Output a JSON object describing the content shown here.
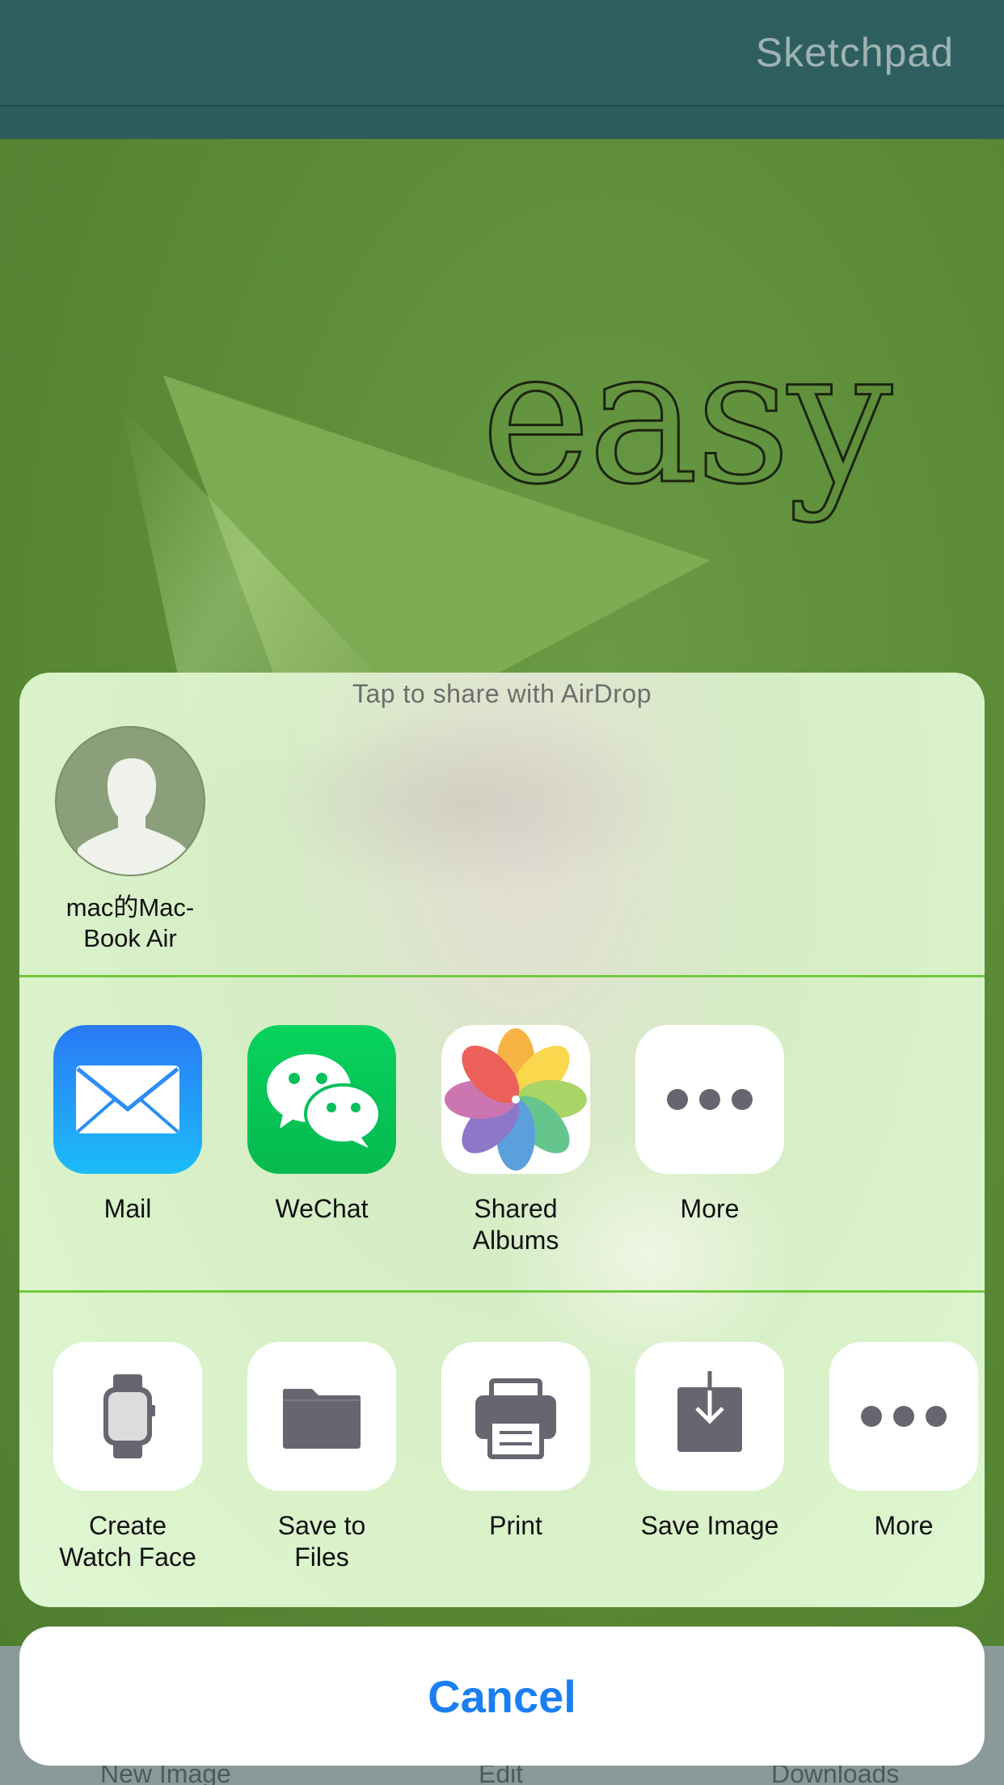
{
  "navbar": {
    "title": "Sketchpad"
  },
  "canvas": {
    "artwork_text": "easy"
  },
  "toolbar": {
    "items": [
      "New Image",
      "Edit",
      "Downloads"
    ]
  },
  "share_sheet": {
    "airdrop_hint": "Tap to share with AirDrop",
    "airdrop_device": {
      "name": "mac的Mac-\nBook Air"
    },
    "apps": [
      {
        "label": "Mail",
        "icon": "mail-icon"
      },
      {
        "label": "WeChat",
        "icon": "wechat-icon"
      },
      {
        "label": "Shared\nAlbums",
        "icon": "photos-icon"
      },
      {
        "label": "More",
        "icon": "more-icon"
      }
    ],
    "actions": [
      {
        "label": "Create\nWatch Face",
        "icon": "watch-icon"
      },
      {
        "label": "Save to Files",
        "icon": "folder-icon"
      },
      {
        "label": "Print",
        "icon": "printer-icon"
      },
      {
        "label": "Save Image",
        "icon": "download-icon"
      },
      {
        "label": "More",
        "icon": "more-icon"
      }
    ]
  },
  "cancel": {
    "label": "Cancel"
  },
  "colors": {
    "accent": "#1a7ef2",
    "divider": "#72c93e",
    "navbar": "#2f5e60"
  }
}
